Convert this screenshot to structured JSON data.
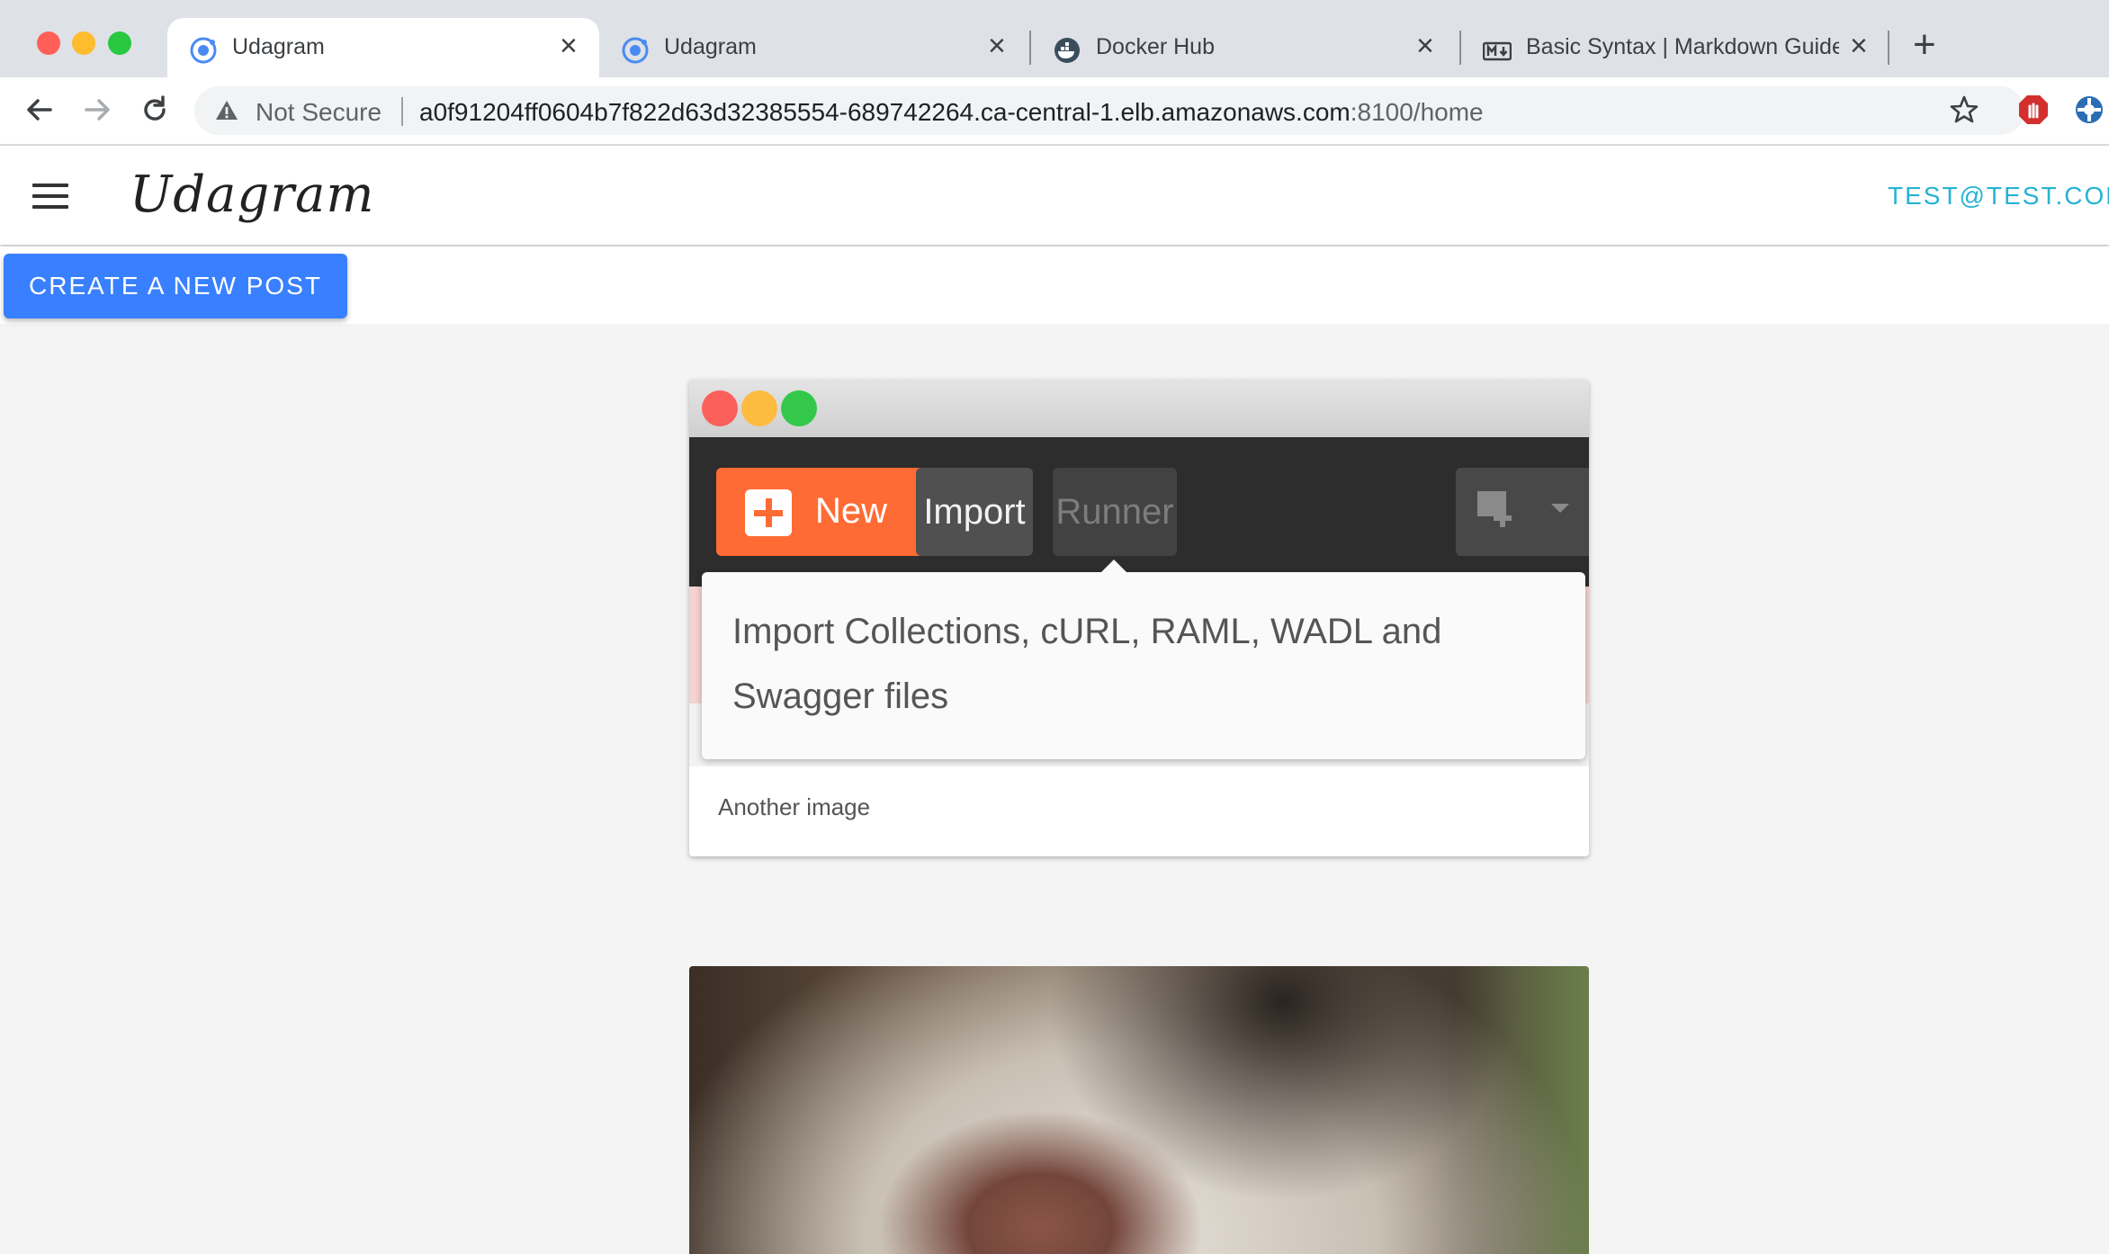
{
  "browser": {
    "tabs": [
      {
        "title": "Udagram",
        "favicon": "udagram-icon",
        "active": true
      },
      {
        "title": "Udagram",
        "favicon": "udagram-icon",
        "active": false
      },
      {
        "title": "Docker Hub",
        "favicon": "docker-icon",
        "active": false
      },
      {
        "title": "Basic Syntax | Markdown Guide",
        "favicon": "markdown-icon",
        "active": false
      }
    ],
    "security_label": "Not Secure",
    "url_host": "a0f91204ff0604b7f822d63d32385554-689742264.ca-central-1.elb.amazonaws.com",
    "url_path": ":8100/home"
  },
  "app": {
    "brand": "Udagram",
    "user": "TEST@TEST.COM",
    "create_button": "CREATE A NEW POST",
    "accent_color": "#3880ff"
  },
  "feed": {
    "posts": [
      {
        "caption": "Another image",
        "image": {
          "new_label": "New",
          "import_label": "Import",
          "runner_label": "Runner",
          "tooltip": "Import Collections, cURL, RAML, WADL and Swagger files"
        }
      }
    ]
  }
}
